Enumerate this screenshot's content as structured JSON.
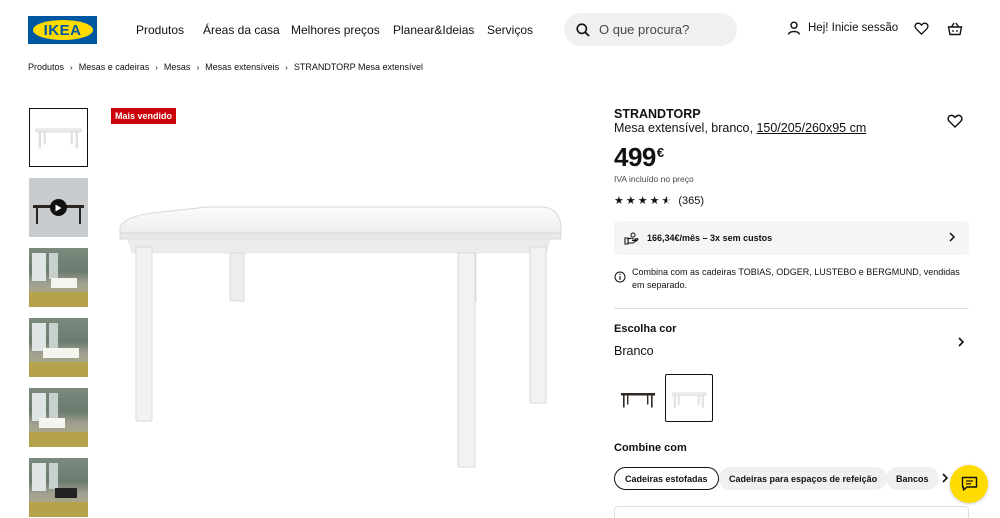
{
  "header": {
    "logo_text": "IKEA",
    "nav": [
      "Produtos",
      "Áreas da casa",
      "Melhores preços",
      "Planear&Ideias",
      "Serviços"
    ],
    "search_placeholder": "O que procura?",
    "login_label": "Hej! Inicie sessão",
    "icons": {
      "search": "search-icon",
      "user": "user-icon",
      "favorites": "heart-icon",
      "cart": "cart-icon"
    }
  },
  "breadcrumb": [
    "Produtos",
    "Mesas e cadeiras",
    "Mesas",
    "Mesas extensíveis",
    "STRANDTORP Mesa extensível"
  ],
  "gallery": {
    "badge": "Mais vendido",
    "thumbnail_count": 6
  },
  "product": {
    "name": "STRANDTORP",
    "description": "Mesa extensível, branco,",
    "dimensions": "150/205/260x95 cm",
    "price": "499",
    "currency": "€",
    "vat_note": "IVA incluído no preço",
    "rating_stars": 4.5,
    "review_count": "(365)",
    "payment_offer": "166,34€/mês – 3x sem custos",
    "info_note": "Combina com as cadeiras TOBIAS, ODGER, LUSTEBO e BERGMUND, vendidas em separado.",
    "color_title": "Escolha cor",
    "color_selected": "Branco",
    "combine_title": "Combine com",
    "combine_chips": [
      "Cadeiras estofadas",
      "Cadeiras para espaços de refeição",
      "Bancos"
    ]
  },
  "colors": {
    "brand_blue": "#0058a3",
    "brand_yellow": "#ffdb00",
    "badge_red": "#cc0008"
  }
}
